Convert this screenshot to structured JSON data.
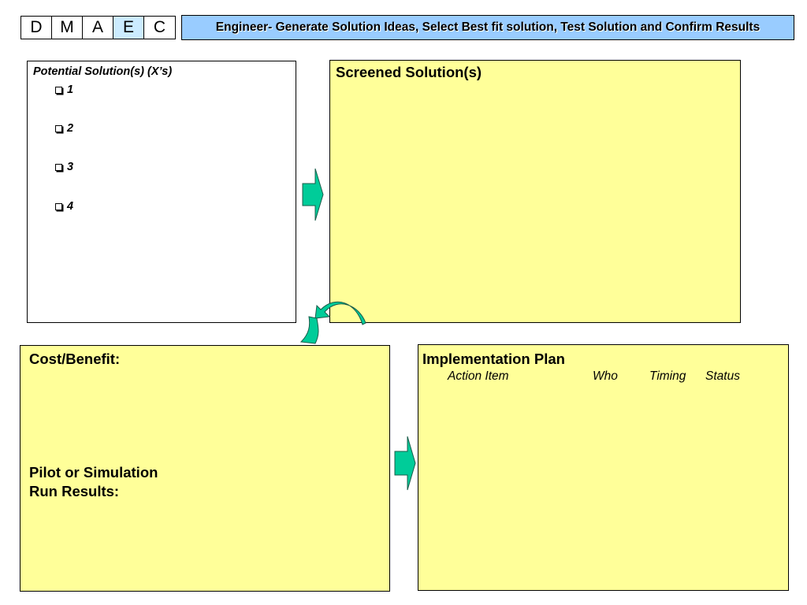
{
  "phases": [
    {
      "label": "D",
      "active": false
    },
    {
      "label": "M",
      "active": false
    },
    {
      "label": "A",
      "active": false
    },
    {
      "label": "E",
      "active": true
    },
    {
      "label": "C",
      "active": false
    }
  ],
  "banner": {
    "title": "Engineer- Generate Solution Ideas, Select Best fit solution, Test Solution and Confirm Results"
  },
  "potential": {
    "heading": "Potential Solution(s) (X’s)",
    "items": [
      "1",
      "2",
      "3",
      "4"
    ]
  },
  "screened": {
    "heading": "Screened Solution(s)"
  },
  "cost_benefit": {
    "heading": "Cost/Benefit:",
    "pilot_line1": "Pilot or Simulation",
    "pilot_line2": "Run Results:"
  },
  "implementation": {
    "heading": "Implementation Plan",
    "columns": [
      "Action Item",
      "Who",
      "Timing",
      "Status"
    ]
  },
  "colors": {
    "panel": "#ffff99",
    "banner": "#99ccff",
    "active_phase": "#ccecff",
    "arrow_fill": "#00cc99",
    "arrow_stroke": "#1a5c4a"
  },
  "icons": {
    "right_arrow": "block-arrow-right-icon",
    "curved_arrow": "curved-arrow-down-icon",
    "checkbox": "checkbox-icon"
  }
}
